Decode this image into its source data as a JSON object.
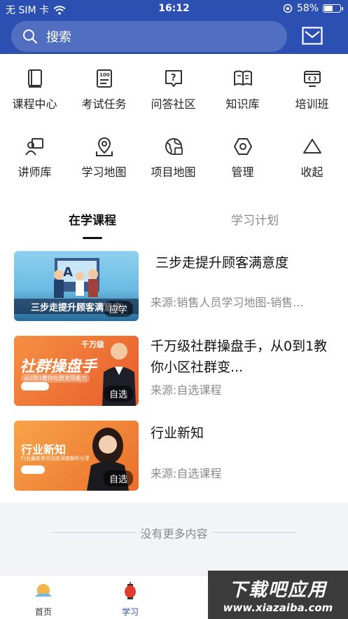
{
  "status_bar": {
    "carrier": "无 SIM 卡",
    "time": "16:12",
    "battery": "58%",
    "battery_level": 0.58
  },
  "header": {
    "search_placeholder": "搜索"
  },
  "grid": [
    {
      "label": "课程中心",
      "icon": "book-icon"
    },
    {
      "label": "考试任务",
      "icon": "exam-icon"
    },
    {
      "label": "问答社区",
      "icon": "question-icon"
    },
    {
      "label": "知识库",
      "icon": "open-book-icon"
    },
    {
      "label": "培训班",
      "icon": "training-icon"
    },
    {
      "label": "讲师库",
      "icon": "lecturer-icon"
    },
    {
      "label": "学习地图",
      "icon": "map-pin-icon"
    },
    {
      "label": "项目地图",
      "icon": "globe-icon"
    },
    {
      "label": "管理",
      "icon": "hexagon-settings-icon"
    },
    {
      "label": "收起",
      "icon": "triangle-collapse-icon"
    }
  ],
  "tabs": [
    {
      "label": "在学课程"
    },
    {
      "label": "学习计划"
    }
  ],
  "courses": [
    {
      "title": "三步走提升顾客满意度",
      "source": "来源:销售人员学习地图-销售...",
      "badge": "应学",
      "thumb_text": "三步走提升顾客满意度",
      "thumb_colors": [
        "#8fd0ef",
        "#2b6b98"
      ]
    },
    {
      "title": " 千万级社群操盘手，从0到1教你小区社群变...",
      "source": "来源:自选课程",
      "badge": "自选",
      "thumb_text": "社群操盘手",
      "thumb_sub": "千万级",
      "thumb_tag": "从0到1教你社群变现能力",
      "thumb_colors": [
        "#f08a3c",
        "#e6552a"
      ]
    },
    {
      "title": "行业新知",
      "source": "来源:自选课程",
      "badge": "自选",
      "thumb_text": "行业新知",
      "thumb_tag": "行业最新资讯动态深度解析分享",
      "thumb_colors": [
        "#f59a42",
        "#e8702a"
      ]
    }
  ],
  "footer": {
    "no_more": "没有更多内容"
  },
  "tabbar": [
    {
      "label": "首页"
    },
    {
      "label": "学习"
    }
  ],
  "watermark": {
    "main": "下载吧应用",
    "url": "www.xiazaiba.com"
  },
  "colors": {
    "primary": "#2c4fb2",
    "accent": "#1e3fa0"
  }
}
